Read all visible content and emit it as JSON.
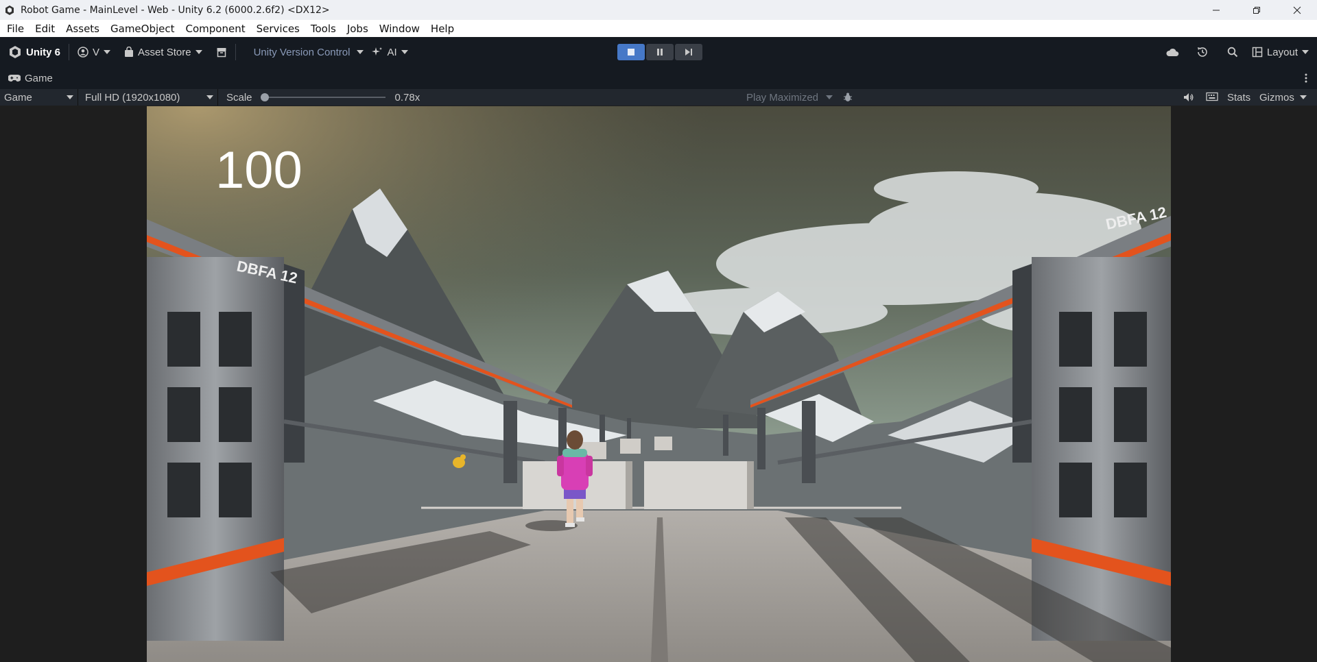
{
  "window": {
    "title": "Robot Game - MainLevel - Web - Unity 6.2 (6000.2.6f2) <DX12>"
  },
  "menu": [
    "File",
    "Edit",
    "Assets",
    "GameObject",
    "Component",
    "Services",
    "Tools",
    "Jobs",
    "Window",
    "Help"
  ],
  "toolbar": {
    "unity_label": "Unity 6",
    "account_label": "V",
    "asset_store_label": "Asset Store",
    "version_control_label": "Unity Version Control",
    "ai_label": "AI",
    "layout_label": "Layout"
  },
  "panel": {
    "tab_label": "Game"
  },
  "game_toolbar": {
    "display_mode": "Game",
    "resolution": "Full HD (1920x1080)",
    "scale_label": "Scale",
    "scale_value": "0.78x",
    "scale_fraction": 0.0,
    "play_mode": "Play Maximized",
    "stats_label": "Stats",
    "gizmos_label": "Gizmos"
  },
  "game": {
    "score": "100",
    "bridge_sign_left": "DBFA 12",
    "bridge_sign_right": "DBFA 12"
  },
  "colors": {
    "play_active": "#4678c7",
    "toolbar_bg": "#151a21",
    "orange_stripe": "#e3531d",
    "outfit_pink": "#d83fb5"
  }
}
